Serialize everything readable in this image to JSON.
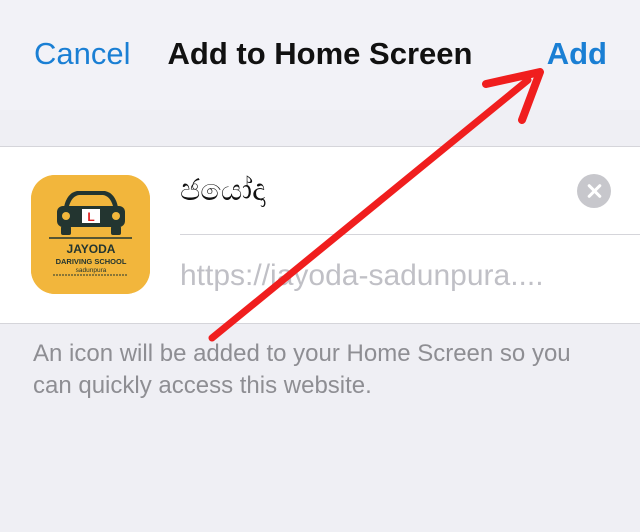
{
  "nav": {
    "cancel_label": "Cancel",
    "title": "Add to Home Screen",
    "add_label": "Add"
  },
  "app": {
    "icon_text_line1": "JAYODA",
    "icon_text_line2": "DARIVING SCHOOL",
    "icon_text_line3": "sadunpura",
    "icon_badge": "L",
    "name_value": "ජයෝදා",
    "url_value": "https://jayoda-sadunpura...."
  },
  "footer": {
    "note": "An icon will be added to your Home Screen so you can quickly access this website."
  },
  "colors": {
    "accent": "#1a7fd4",
    "icon_background": "#f2b63c",
    "annotation_arrow": "#f01e1e"
  },
  "icons": {
    "clear": "clear-circle-icon",
    "car": "car-icon",
    "arrow": "red-arrow-annotation"
  }
}
